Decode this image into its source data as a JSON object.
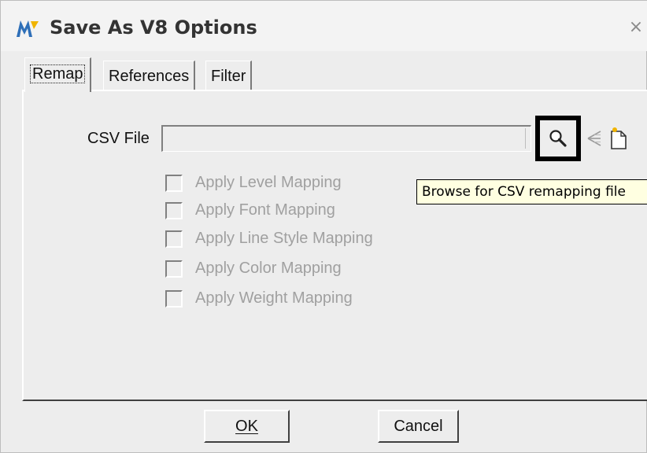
{
  "window": {
    "title": "Save As V8 Options",
    "close_symbol": "×",
    "logo_icon": "microstation-logo-icon"
  },
  "tabs": [
    {
      "label": "Remap",
      "active": true
    },
    {
      "label": "References",
      "active": false
    },
    {
      "label": "Filter",
      "active": false
    }
  ],
  "remap": {
    "csv_label": "CSV File",
    "csv_value": "",
    "browse_icon": "magnifier-icon",
    "extra_icons": [
      "branch-icon",
      "new-file-icon"
    ],
    "options": [
      {
        "label": "Apply Level Mapping",
        "checked": false,
        "enabled": false
      },
      {
        "label": "Apply Font Mapping",
        "checked": false,
        "enabled": false
      },
      {
        "label": "Apply Line Style Mapping",
        "checked": false,
        "enabled": false
      },
      {
        "label": "Apply Color Mapping",
        "checked": false,
        "enabled": false
      },
      {
        "label": "Apply Weight Mapping",
        "checked": false,
        "enabled": false
      }
    ]
  },
  "tooltip": {
    "text": "Browse for CSV remapping file"
  },
  "buttons": {
    "ok_label": "OK",
    "cancel_label": "Cancel"
  },
  "colors": {
    "logo": "#2e6fb8",
    "tooltip_bg": "#ffffe1",
    "highlight_border": "#000000"
  }
}
